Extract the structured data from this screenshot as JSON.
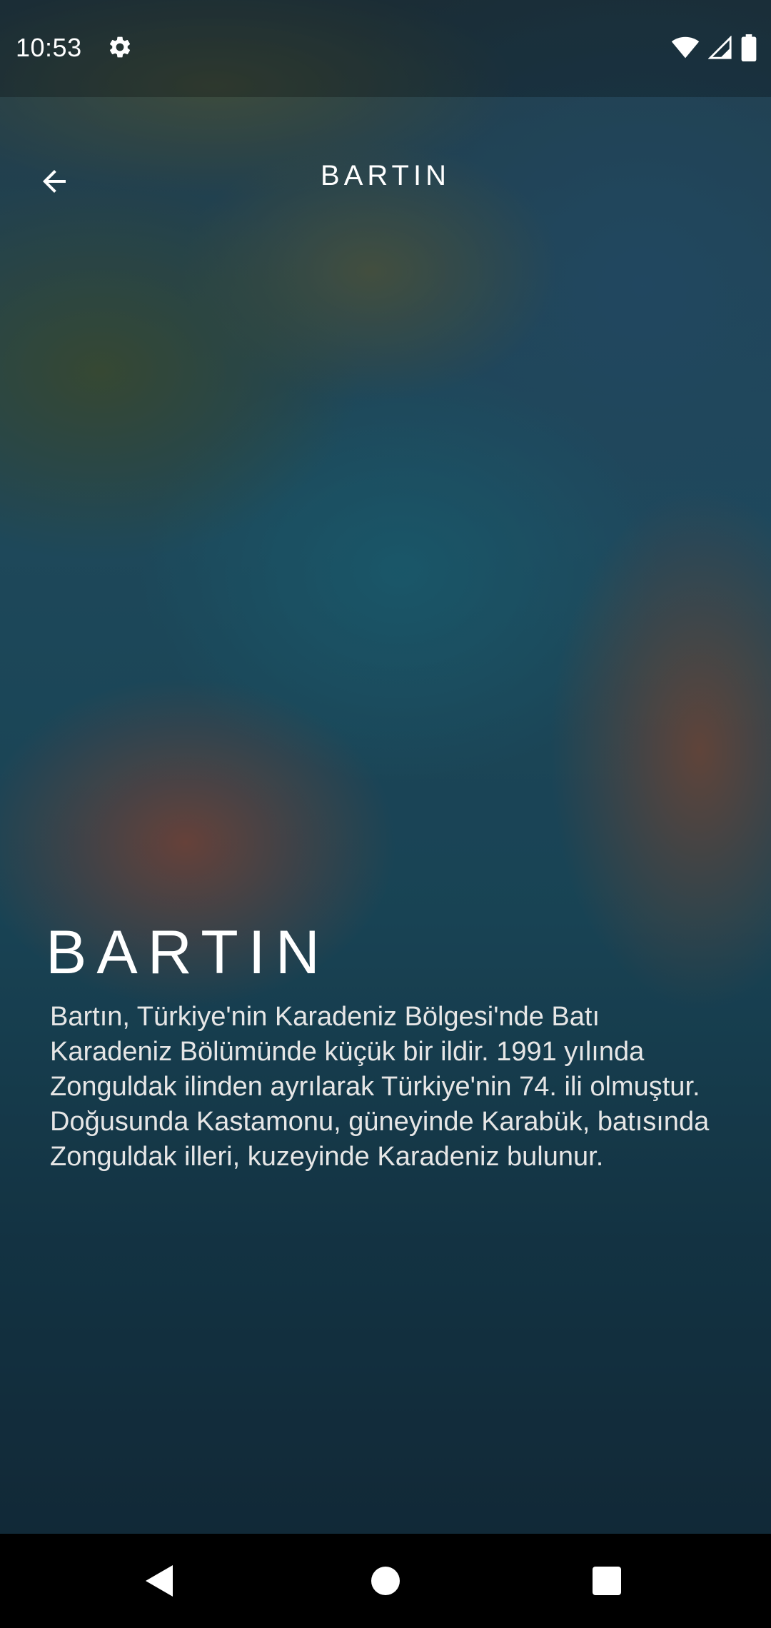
{
  "status_bar": {
    "time": "10:53",
    "icons": [
      "settings-icon",
      "wifi-icon",
      "signal-icon",
      "battery-icon"
    ]
  },
  "app_bar": {
    "back_icon": "arrow-back-icon",
    "title": "BARTIN"
  },
  "content": {
    "heading": "BARTIN",
    "description": "Bartın, Türkiye'nin Karadeniz Bölgesi'nde Batı Karadeniz Bölümünde küçük bir ildir. 1991 yılında Zonguldak ilinden ayrılarak Türkiye'nin 74. ili olmuştur. Doğusunda Kastamonu, güneyinde Karabük, batısında Zonguldak illeri, kuzeyinde Karadeniz bulunur."
  },
  "nav_bar": {
    "buttons": [
      "back-triangle-icon",
      "home-circle-icon",
      "recents-square-icon"
    ]
  },
  "colors": {
    "text": "#ffffff",
    "description_text": "#e6e6e6",
    "nav_bar": "#000000"
  }
}
